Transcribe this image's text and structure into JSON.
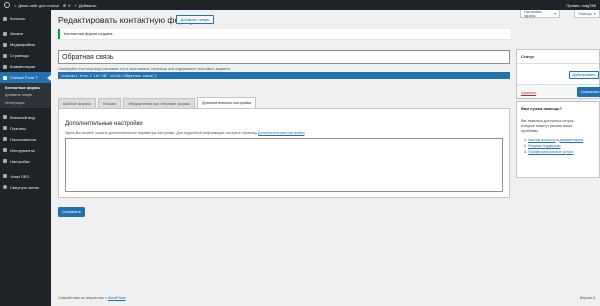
{
  "adminbar": {
    "site_name": "Демо сайт для статьи",
    "comments_count": "0",
    "new_label": "Добавить",
    "greeting": "Привет, mag788"
  },
  "sidebar": {
    "items": [
      {
        "label": "Консоль",
        "icon": "dashboard-icon"
      },
      {
        "label": "Записи",
        "icon": "pin-icon"
      },
      {
        "label": "Медиафайлы",
        "icon": "media-icon"
      },
      {
        "label": "Страницы",
        "icon": "page-icon"
      },
      {
        "label": "Комментарии",
        "icon": "comment-icon"
      },
      {
        "label": "Contact Form 7",
        "icon": "mail-icon"
      }
    ],
    "submenu": [
      "Контактные формы",
      "Добавить новую",
      "Интеграция"
    ],
    "items2": [
      {
        "label": "Внешний вид",
        "icon": "brush-icon"
      },
      {
        "label": "Плагины",
        "icon": "plugin-icon"
      },
      {
        "label": "Пользователи",
        "icon": "users-icon"
      },
      {
        "label": "Инструменты",
        "icon": "tools-icon"
      },
      {
        "label": "Настройки",
        "icon": "settings-icon"
      }
    ],
    "items3": [
      {
        "label": "Yoast SEO",
        "icon": "yoast-icon"
      },
      {
        "label": "Свернуть меню",
        "icon": "collapse-icon"
      }
    ]
  },
  "screen": {
    "options_label": "Настройки экрана",
    "help_label": "Помощь"
  },
  "page": {
    "title": "Редактировать контактную форму",
    "add_new": "Добавить новую",
    "notice": "Контактная форма создана.",
    "form_title": "Обратная связь",
    "hint": "Скопируйте этот шорткод и вставьте его в свои записи, страницы или содержимое текстового виджета:",
    "shortcode": "[contact-form-7 id=\"18\" title=\"Обратная связь\"]"
  },
  "tabs": [
    "Шаблон формы",
    "Письмо",
    "Уведомления при отправке формы",
    "Дополнительные настройки"
  ],
  "panel": {
    "heading": "Дополнительные настройки",
    "desc": "Здесь Вы можете указать дополнительные параметры настройки. Для подробной информации смотрите страницу",
    "link": "Дополнительные настройки",
    "link_tail": "."
  },
  "save_button": "Сохранить",
  "status_box": {
    "title": "Статус",
    "duplicate": "Дублировать",
    "delete": "Удалить",
    "save": "Сохранить"
  },
  "help_box": {
    "title": "Вам нужна помощь?",
    "text": "Ваг неколько доступных ситрок, которые помогут решить ваши проблемы.",
    "items": [
      {
        "link": "Частые вопросы",
        "sep": " и ",
        "link2": "документация"
      },
      {
        "link": "Форумы поддержки",
        "sep": "",
        "link2": ""
      },
      {
        "link": "Профессиональные услуги",
        "sep": "",
        "link2": ""
      }
    ]
  },
  "footer": {
    "thanks_prefix": "Спасибо вам за творчество с ",
    "wp_link": "WordPress",
    "version": "Версия 6."
  }
}
